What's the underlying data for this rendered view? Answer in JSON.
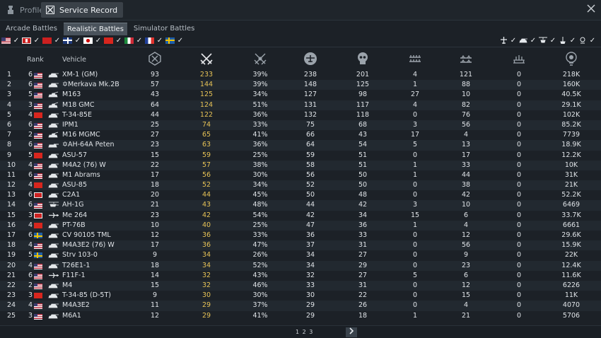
{
  "window": {
    "tabs": [
      {
        "label": "Profile",
        "active": false,
        "icon": "profile-icon"
      },
      {
        "label": "Service Record",
        "active": true,
        "icon": "service-record-icon"
      }
    ],
    "close_icon": "close-icon"
  },
  "mode_tabs": [
    {
      "label": "Arcade Battles",
      "active": false
    },
    {
      "label": "Realistic Battles",
      "active": true
    },
    {
      "label": "Simulator Battles",
      "active": false
    }
  ],
  "nation_filters": [
    {
      "name": "usa",
      "checked": true
    },
    {
      "name": "germany",
      "checked": true
    },
    {
      "name": "ussr",
      "checked": true
    },
    {
      "name": "britain",
      "checked": true
    },
    {
      "name": "japan",
      "checked": true
    },
    {
      "name": "china",
      "checked": true
    },
    {
      "name": "italy",
      "checked": true
    },
    {
      "name": "france",
      "checked": true
    },
    {
      "name": "sweden",
      "checked": true
    }
  ],
  "vehicle_type_filters": [
    {
      "name": "aircraft-icon",
      "checked": true
    },
    {
      "name": "tank-icon",
      "checked": true
    },
    {
      "name": "helicopter-icon",
      "checked": true
    },
    {
      "name": "ship-icon",
      "checked": true
    },
    {
      "name": "boat-icon",
      "checked": true
    }
  ],
  "columns": {
    "index": "",
    "rank": "Rank",
    "vehicle": "Vehicle",
    "stat_icons": [
      "battles-icon",
      "victories-icon",
      "win-rate-icon",
      "air-targets-destroyed-icon",
      "ground-targets-destroyed-icon",
      "naval-targets-destroyed-icon",
      "naval-ground-targets-icon",
      "ship-targets-icon",
      "activity-icon"
    ]
  },
  "rows": [
    {
      "idx": "1",
      "rank": "6",
      "nation": "usa",
      "vtype": "tank",
      "name": "XM-1 (GM)",
      "s": [
        "93",
        "233",
        "39%",
        "238",
        "201",
        "4",
        "121",
        "0",
        "218K"
      ]
    },
    {
      "idx": "2",
      "rank": "6",
      "nation": "usa",
      "vtype": "tank",
      "name": "✡Merkava Mk.2B",
      "s": [
        "57",
        "144",
        "39%",
        "148",
        "125",
        "1",
        "88",
        "0",
        "160K"
      ]
    },
    {
      "idx": "3",
      "rank": "5",
      "nation": "usa",
      "vtype": "spaa",
      "name": "M163",
      "s": [
        "43",
        "125",
        "34%",
        "127",
        "98",
        "27",
        "10",
        "0",
        "40.5K"
      ]
    },
    {
      "idx": "4",
      "rank": "3",
      "nation": "usa",
      "vtype": "spaa",
      "name": "M18 GMC",
      "s": [
        "64",
        "124",
        "51%",
        "131",
        "117",
        "4",
        "82",
        "0",
        "29.1K"
      ]
    },
    {
      "idx": "5",
      "rank": "4",
      "nation": "china",
      "vtype": "tank",
      "name": "T-34-85E",
      "s": [
        "44",
        "122",
        "36%",
        "132",
        "118",
        "0",
        "76",
        "0",
        "102K"
      ]
    },
    {
      "idx": "6",
      "rank": "6",
      "nation": "usa",
      "vtype": "tank",
      "name": "IPM1",
      "s": [
        "25",
        "74",
        "33%",
        "75",
        "68",
        "3",
        "56",
        "0",
        "85.2K"
      ]
    },
    {
      "idx": "7",
      "rank": "2",
      "nation": "usa",
      "vtype": "spaa",
      "name": "M16 MGMC",
      "s": [
        "27",
        "65",
        "41%",
        "66",
        "43",
        "17",
        "4",
        "0",
        "7739"
      ]
    },
    {
      "idx": "8",
      "rank": "6",
      "nation": "usa",
      "vtype": "td",
      "name": "✡AH-64A Peten",
      "s": [
        "23",
        "63",
        "36%",
        "64",
        "54",
        "5",
        "13",
        "0",
        "18.9K"
      ]
    },
    {
      "idx": "9",
      "rank": "5",
      "nation": "china",
      "vtype": "tank",
      "name": "ASU-57",
      "s": [
        "15",
        "59",
        "25%",
        "59",
        "51",
        "0",
        "17",
        "0",
        "12.2K"
      ]
    },
    {
      "idx": "10",
      "rank": "4",
      "nation": "usa",
      "vtype": "tank",
      "name": "M4A2 (76) W",
      "s": [
        "22",
        "57",
        "38%",
        "58",
        "51",
        "1",
        "33",
        "0",
        "10K"
      ]
    },
    {
      "idx": "11",
      "rank": "6",
      "nation": "usa",
      "vtype": "tank",
      "name": "M1 Abrams",
      "s": [
        "17",
        "56",
        "30%",
        "56",
        "50",
        "1",
        "44",
        "0",
        "31K"
      ]
    },
    {
      "idx": "12",
      "rank": "4",
      "nation": "china",
      "vtype": "tank",
      "name": "ASU-85",
      "s": [
        "18",
        "52",
        "34%",
        "52",
        "50",
        "0",
        "38",
        "0",
        "21K"
      ]
    },
    {
      "idx": "13",
      "rank": "6",
      "nation": "germany",
      "vtype": "tank",
      "name": "C2A1",
      "s": [
        "20",
        "44",
        "45%",
        "50",
        "48",
        "0",
        "42",
        "0",
        "52.2K"
      ]
    },
    {
      "idx": "14",
      "rank": "6",
      "nation": "usa",
      "vtype": "helicopter",
      "name": "AH-1G",
      "s": [
        "21",
        "43",
        "48%",
        "44",
        "42",
        "3",
        "10",
        "0",
        "6469"
      ]
    },
    {
      "idx": "15",
      "rank": "3",
      "nation": "germany",
      "vtype": "aircraft",
      "name": "Me 264",
      "s": [
        "23",
        "42",
        "54%",
        "42",
        "34",
        "15",
        "6",
        "0",
        "33.7K"
      ]
    },
    {
      "idx": "16",
      "rank": "4",
      "nation": "china",
      "vtype": "tank",
      "name": "PT-76B",
      "s": [
        "10",
        "40",
        "25%",
        "47",
        "36",
        "1",
        "4",
        "0",
        "6661"
      ]
    },
    {
      "idx": "17",
      "rank": "6",
      "nation": "sweden",
      "vtype": "tank",
      "name": "CV 90105 TML",
      "s": [
        "12",
        "36",
        "33%",
        "36",
        "33",
        "0",
        "12",
        "0",
        "29.6K"
      ]
    },
    {
      "idx": "18",
      "rank": "4",
      "nation": "usa",
      "vtype": "tank",
      "name": "M4A3E2 (76) W",
      "s": [
        "17",
        "36",
        "47%",
        "37",
        "31",
        "0",
        "56",
        "0",
        "15.9K"
      ]
    },
    {
      "idx": "19",
      "rank": "5",
      "nation": "sweden",
      "vtype": "tank",
      "name": "Strv 103-0",
      "s": [
        "9",
        "34",
        "26%",
        "34",
        "27",
        "0",
        "9",
        "0",
        "22K"
      ]
    },
    {
      "idx": "20",
      "rank": "4",
      "nation": "usa",
      "vtype": "tank",
      "name": "T26E1-1",
      "s": [
        "18",
        "34",
        "52%",
        "34",
        "29",
        "0",
        "23",
        "0",
        "12.4K"
      ]
    },
    {
      "idx": "21",
      "rank": "6",
      "nation": "usa",
      "vtype": "aircraft",
      "name": "F11F-1",
      "s": [
        "14",
        "32",
        "43%",
        "32",
        "27",
        "5",
        "6",
        "0",
        "11.6K"
      ]
    },
    {
      "idx": "22",
      "rank": "2",
      "nation": "usa",
      "vtype": "tank",
      "name": "M4",
      "s": [
        "15",
        "32",
        "46%",
        "33",
        "31",
        "0",
        "12",
        "0",
        "6226"
      ]
    },
    {
      "idx": "23",
      "rank": "3",
      "nation": "china",
      "vtype": "tank",
      "name": "T-34-85 (D-5T)",
      "s": [
        "9",
        "30",
        "30%",
        "30",
        "22",
        "0",
        "15",
        "0",
        "11K"
      ]
    },
    {
      "idx": "24",
      "rank": "4",
      "nation": "usa",
      "vtype": "tank",
      "name": "M4A3E2",
      "s": [
        "11",
        "29",
        "37%",
        "29",
        "26",
        "0",
        "4",
        "0",
        "4070"
      ]
    },
    {
      "idx": "25",
      "rank": "3",
      "nation": "usa",
      "vtype": "tank",
      "name": "M6A1",
      "s": [
        "12",
        "29",
        "41%",
        "29",
        "18",
        "1",
        "21",
        "0",
        "5706"
      ]
    }
  ],
  "pagination": {
    "pages": "1 2 3",
    "next_icon": "chevron-right-icon"
  },
  "colors": {
    "highlight_col": "#e6c256",
    "active_tab": "#4a535c",
    "bg": "#1c2127"
  }
}
